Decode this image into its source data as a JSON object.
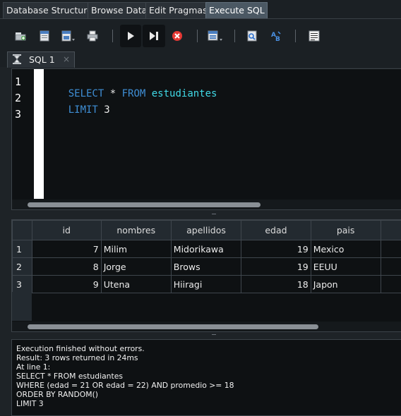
{
  "tabs": [
    {
      "label": "Database Structure",
      "active": false
    },
    {
      "label": "Browse Data",
      "active": false
    },
    {
      "label": "Edit Pragmas",
      "active": false
    },
    {
      "label": "Execute SQL",
      "active": true
    }
  ],
  "toolbar": {
    "icons": [
      "open-tab-icon",
      "open-sql-file-icon",
      "save-sql-file-icon",
      "print-icon",
      "execute-all-icon",
      "execute-line-icon",
      "stop-execution-icon",
      "save-results-icon",
      "find-icon",
      "find-replace-icon",
      "comment-icon"
    ]
  },
  "editor_tab": {
    "label": "SQL 1",
    "close": "×"
  },
  "editor": {
    "line_numbers": [
      "1",
      "2",
      "3"
    ],
    "lines": [
      [
        {
          "t": "SELECT",
          "c": "kw"
        },
        {
          "t": " * ",
          "c": "num"
        },
        {
          "t": "FROM",
          "c": "kw"
        },
        {
          "t": " ",
          "c": "num"
        },
        {
          "t": "estudiantes",
          "c": "id"
        }
      ],
      [
        {
          "t": "LIMIT",
          "c": "kw"
        },
        {
          "t": " 3",
          "c": "num"
        }
      ],
      []
    ]
  },
  "results": {
    "columns": [
      "id",
      "nombres",
      "apellidos",
      "edad",
      "pais",
      ""
    ],
    "rows": [
      {
        "row_number": "1",
        "id": "7",
        "nombres": "Milim",
        "apellidos": "Midorikawa",
        "edad": "19",
        "pais": "Mexico"
      },
      {
        "row_number": "2",
        "id": "8",
        "nombres": "Jorge",
        "apellidos": "Brows",
        "edad": "19",
        "pais": "EEUU"
      },
      {
        "row_number": "3",
        "id": "9",
        "nombres": "Utena",
        "apellidos": "Hiiragi",
        "edad": "18",
        "pais": "Japon"
      }
    ]
  },
  "messages": {
    "lines": [
      "Execution finished without errors.",
      "Result: 3 rows returned in 24ms",
      "At line 1:",
      "SELECT * FROM estudiantes",
      "WHERE (edad = 21 OR edad = 22) AND promedio >= 18",
      "ORDER BY RANDOM()",
      "LIMIT 3"
    ]
  },
  "colors": {
    "keyword": "#3f8fd6",
    "identifier": "#40d9e6",
    "stop": "#e53935",
    "tab_active": "#4b5863"
  }
}
